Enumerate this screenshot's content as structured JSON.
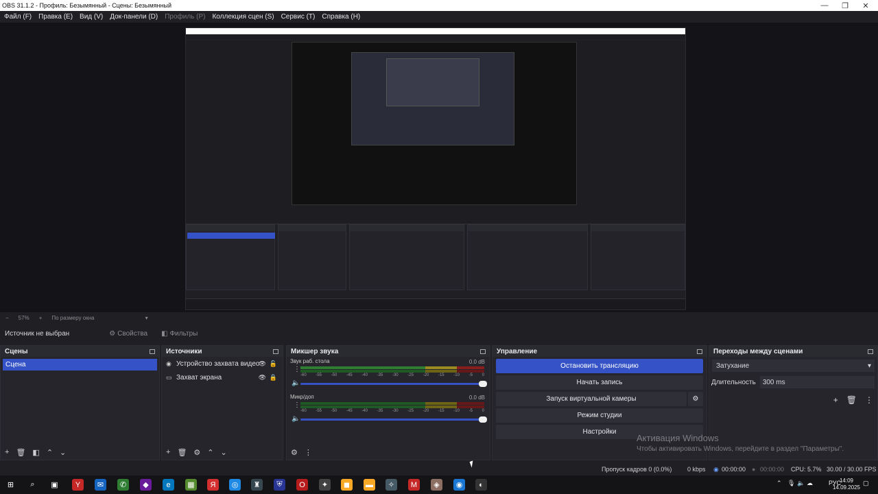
{
  "window": {
    "title": "OBS 31.1.2 - Профиль: Безымянный - Сцены: Безымянный",
    "controls": [
      "—",
      "❐",
      "✕"
    ]
  },
  "menu": [
    {
      "label": "Файл (F)",
      "enabled": true
    },
    {
      "label": "Правка (E)",
      "enabled": true
    },
    {
      "label": "Вид (V)",
      "enabled": true
    },
    {
      "label": "Док-панели (D)",
      "enabled": true
    },
    {
      "label": "Профиль (P)",
      "enabled": false
    },
    {
      "label": "Коллекция сцен (S)",
      "enabled": true
    },
    {
      "label": "Сервис (T)",
      "enabled": true
    },
    {
      "label": "Справка (H)",
      "enabled": true
    }
  ],
  "zoom": {
    "minus": "−",
    "value": "57%",
    "plus": "+",
    "mode": "По размеру окна"
  },
  "source_bar": {
    "status": "Источник не выбран",
    "properties": "Свойства",
    "filters": "Фильтры"
  },
  "scenes": {
    "title": "Сцены",
    "items": [
      "Сцена"
    ]
  },
  "sources": {
    "title": "Источники",
    "items": [
      {
        "name": "Устройство захвата видео",
        "icon": "camera-icon"
      },
      {
        "name": "Захват экрана",
        "icon": "monitor-icon"
      }
    ]
  },
  "mixer": {
    "title": "Микшер звука",
    "channels": [
      {
        "name": "Звук раб. стола",
        "db": "0.0 dB"
      },
      {
        "name": "Микр/доп",
        "db": "0.0 dB"
      }
    ],
    "ticks": [
      "-60",
      "-55",
      "-50",
      "-45",
      "-40",
      "-35",
      "-30",
      "-25",
      "-20",
      "-15",
      "-10",
      "-5",
      "0"
    ]
  },
  "controls": {
    "title": "Управление",
    "stop_stream": "Остановить трансляцию",
    "start_record": "Начать запись",
    "virtual_cam": "Запуск виртуальной камеры",
    "studio_mode": "Режим студии",
    "settings": "Настройки"
  },
  "transitions": {
    "title": "Переходы между сценами",
    "selected": "Затухание",
    "duration_label": "Длительность",
    "duration_value": "300 ms"
  },
  "watermark": {
    "line1": "Активация Windows",
    "line2": "Чтобы активировать Windows, перейдите в раздел \"Параметры\"."
  },
  "status": {
    "dropped": "Пропуск кадров 0 (0.0%)",
    "kbps": "0 kbps",
    "stream_time": "00:00:00",
    "rec_time": "00:00:00",
    "cpu": "CPU: 5.7%",
    "fps": "30.00 / 30.00 FPS"
  },
  "taskbar": {
    "lang": "РУС",
    "time": "14:09",
    "date": "14.09.2025"
  },
  "colors": {
    "accent": "#3553c6",
    "bg": "#1f1f24",
    "dock": "#25252b"
  }
}
